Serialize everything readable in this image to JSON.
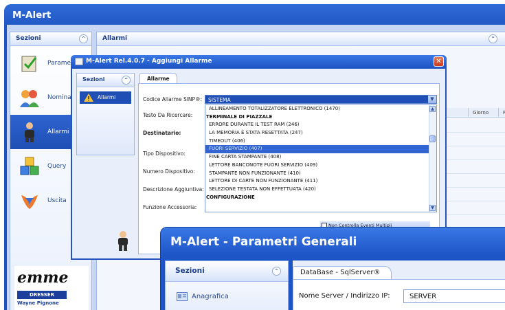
{
  "main": {
    "title": "M-Alert",
    "left_header": "Sezioni",
    "right_header": "Allarmi",
    "nav": [
      {
        "label": "Parametri",
        "icon": "clipboard-check-icon"
      },
      {
        "label": "Nominativi",
        "icon": "users-icon"
      },
      {
        "label": "Allarmi",
        "icon": "person-icon"
      },
      {
        "label": "Query",
        "icon": "query-blocks-icon"
      },
      {
        "label": "Uscita",
        "icon": "exit-icon"
      }
    ],
    "grid_columns": [
      "Giorno",
      "Fi"
    ],
    "brand": {
      "emme": "emme",
      "dresser": "DRESSER",
      "wayne": "Wayne Pignone"
    }
  },
  "dialog": {
    "title": "M-Alert Rel.4.0.7 - Aggiungi Allarme",
    "side_header": "Sezioni",
    "side_item": "Allarmi",
    "tab": "Allarme",
    "labels": {
      "code": "Codice Allarme SINP®:",
      "search": "Testo Da Ricercare:",
      "recipient": "Destinatario:",
      "device_type": "Tipo Dispositivo:",
      "device_number": "Numero Dispositivo:",
      "extra_desc": "Descrizione Aggiuntiva:",
      "accessory": "Funzione Accessoria:"
    },
    "combo_value": "SISTEMA",
    "list": [
      {
        "text": "ALLINEAMENTO TOTALIZZATORE ELETTRONICO (1470)",
        "kind": "item"
      },
      {
        "text": "TERMINALE DI PIAZZALE",
        "kind": "group"
      },
      {
        "text": "ERRORE DURANTE IL TEST RAM (246)",
        "kind": "item"
      },
      {
        "text": "LA MEMORIA È STATA RESETTATA (247)",
        "kind": "item"
      },
      {
        "text": "TIMEOUT (406)",
        "kind": "item"
      },
      {
        "text": "FUORI SERVIZIO (407)",
        "kind": "selected"
      },
      {
        "text": "FINE CARTA STAMPANTE (408)",
        "kind": "item"
      },
      {
        "text": "LETTORE BANCONOTE FUORI SERVIZIO (409)",
        "kind": "item"
      },
      {
        "text": "STAMPANTE NON FUNZIONANTE (410)",
        "kind": "item"
      },
      {
        "text": "LETTORE DI CARTE NON FUNZIONANTE (411)",
        "kind": "item"
      },
      {
        "text": "SELEZIONE TESTATA NON EFFETTUATA (420)",
        "kind": "item"
      },
      {
        "text": "CONFIGURAZIONE",
        "kind": "group"
      }
    ],
    "multi_event_label": "Non Controlla Eventi Multipli"
  },
  "params": {
    "title": "M-Alert - Parametri Generali",
    "side_header": "Sezioni",
    "side_item": "Anagrafica",
    "tab": "DataBase - SqlServer®",
    "server_label": "Nome Server / Indirizzo IP:",
    "server_value": "SERVER"
  }
}
